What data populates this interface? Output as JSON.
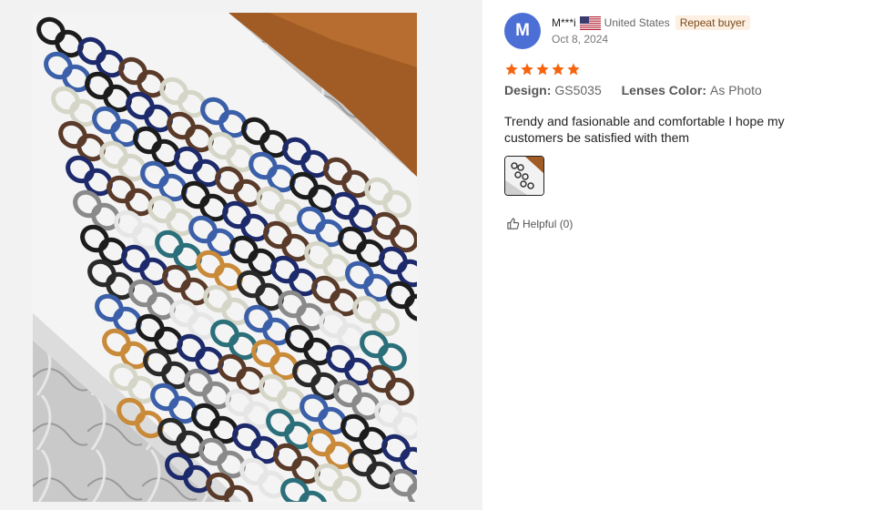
{
  "review": {
    "avatar_letter": "M",
    "username": "M***i",
    "country": "United States",
    "flag_icon": "us-flag-icon",
    "badge": "Repeat buyer",
    "date": "Oct 8, 2024",
    "rating": 5,
    "star_color": "#f5640f",
    "attributes": [
      {
        "label": "Design",
        "value": "GS5035"
      },
      {
        "label": "Lenses Color",
        "value": "As Photo"
      }
    ],
    "text": "Trendy and fasionable and comfortable I hope my customers be satisfied with them",
    "helpful_label": "Helpful (0)",
    "photo_count": 1
  },
  "colors": {
    "avatar_bg": "#4c6fd6",
    "badge_bg": "#fdf0e3",
    "left_panel_bg": "#f2f2f2"
  }
}
